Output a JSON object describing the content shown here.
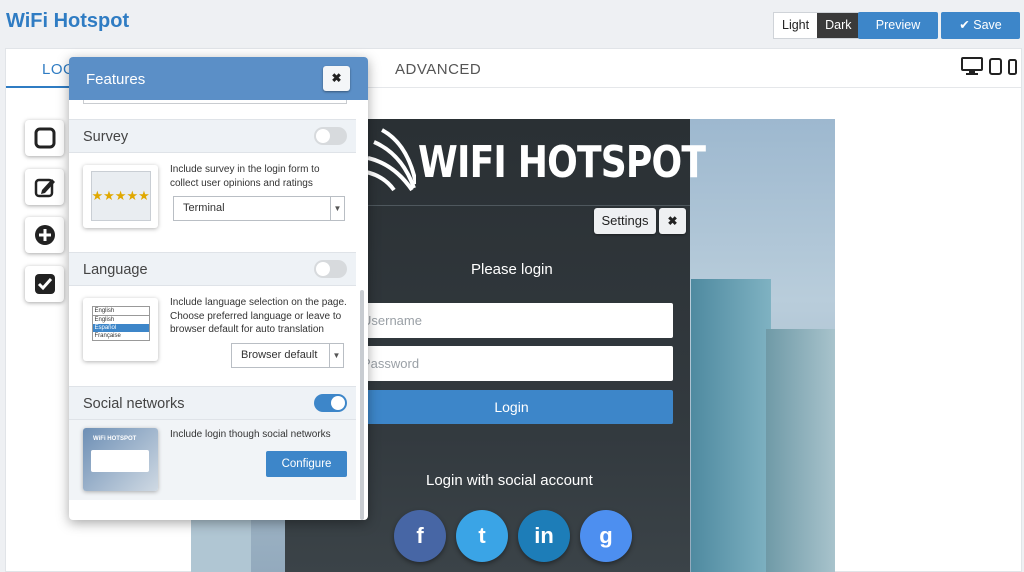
{
  "app": {
    "title": "WiFi Hotspot"
  },
  "theme": {
    "light": "Light",
    "dark": "Dark"
  },
  "toolbar": {
    "preview_label": "Preview",
    "save_label": "Save",
    "save_icon": "check-icon"
  },
  "tabs": [
    {
      "label": "LOGIN",
      "visible": "LOG",
      "active": true
    },
    {
      "label": "ADVANCED",
      "active": false
    }
  ],
  "devices": [
    "desktop-icon",
    "tablet-icon",
    "phone-icon"
  ],
  "tools": [
    "square-icon",
    "edit-icon",
    "add-icon",
    "checkbox-icon"
  ],
  "features": {
    "title": "Features",
    "close": "✖",
    "sections": [
      {
        "title": "Survey",
        "enabled": false,
        "description": "Include survey in the login form to collect user opinions and ratings",
        "select": "Terminal"
      },
      {
        "title": "Language",
        "enabled": false,
        "description": "Include language selection on the page. Choose preferred language or leave to browser default for auto translation",
        "select": "Browser default",
        "thumb_options": [
          "English",
          "English",
          "Español",
          "Française"
        ]
      },
      {
        "title": "Social networks",
        "enabled": true,
        "description": "Include login though social networks",
        "button": "Configure",
        "thumb_title": "WiFi HOTSPOT"
      }
    ]
  },
  "preview": {
    "logo_text": "WIFI HOTSPOT",
    "settings_label": "Settings",
    "close": "✖",
    "please_login": "Please login",
    "username_placeholder": "Username",
    "password_placeholder": "Password",
    "login_button": "Login",
    "social_title": "Login with social account",
    "social": [
      {
        "name": "facebook",
        "glyph": "f",
        "color": "#3b5998"
      },
      {
        "name": "twitter",
        "glyph": "t",
        "color": "#1da1f2"
      },
      {
        "name": "linkedin",
        "glyph": "in",
        "color": "#0077b5"
      },
      {
        "name": "google",
        "glyph": "g",
        "color": "#4285f4"
      }
    ]
  },
  "colors": {
    "accent": "#3d86c9",
    "title": "#2f7cc3",
    "header": "#5b8fc7"
  }
}
